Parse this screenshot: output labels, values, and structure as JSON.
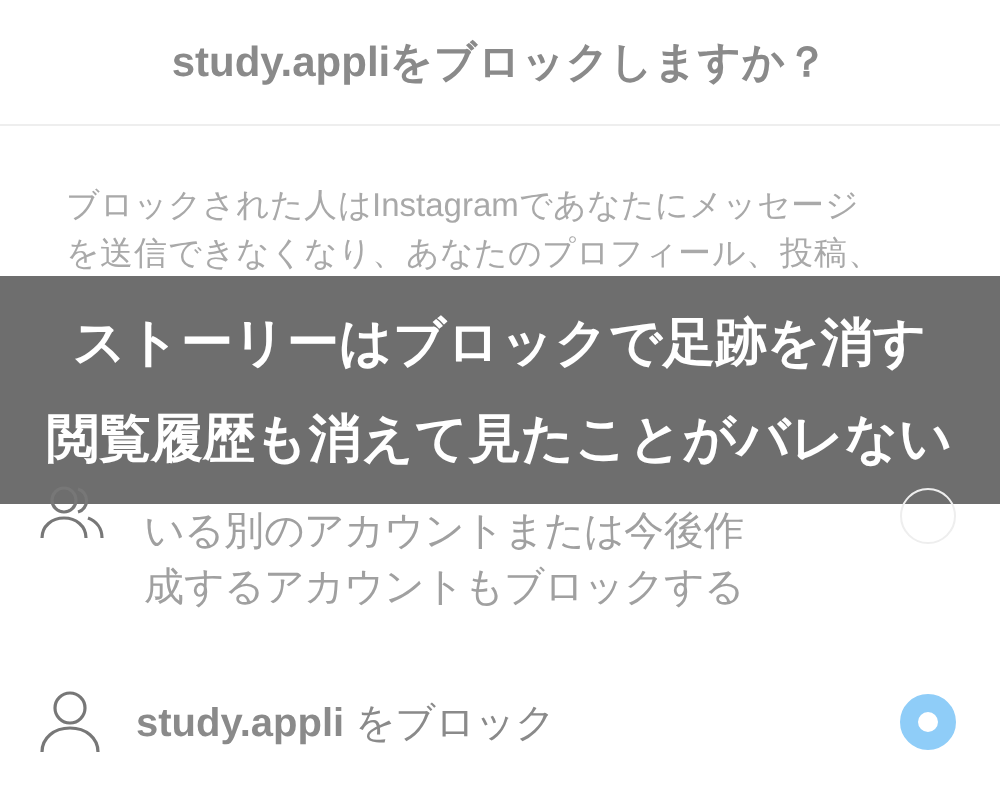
{
  "dialog": {
    "title": "study.appliをブロックしますか？",
    "description_lines": [
      "ブロックされた人はInstagramであなたにメッセージ",
      "を送信できなくなり、あなたのプロフィール、投稿、"
    ]
  },
  "banner": {
    "lines": [
      "ストーリーはブロックで足跡を消す",
      "閲覧履歴も消えて見たことがバレない"
    ]
  },
  "options": [
    {
      "kind": "accounts",
      "text": "いる別のアカウントまたは今後作成するアカウントもブロックする",
      "selected": false
    },
    {
      "kind": "person",
      "text": "**study.appli** をブロック",
      "selected": true
    }
  ]
}
